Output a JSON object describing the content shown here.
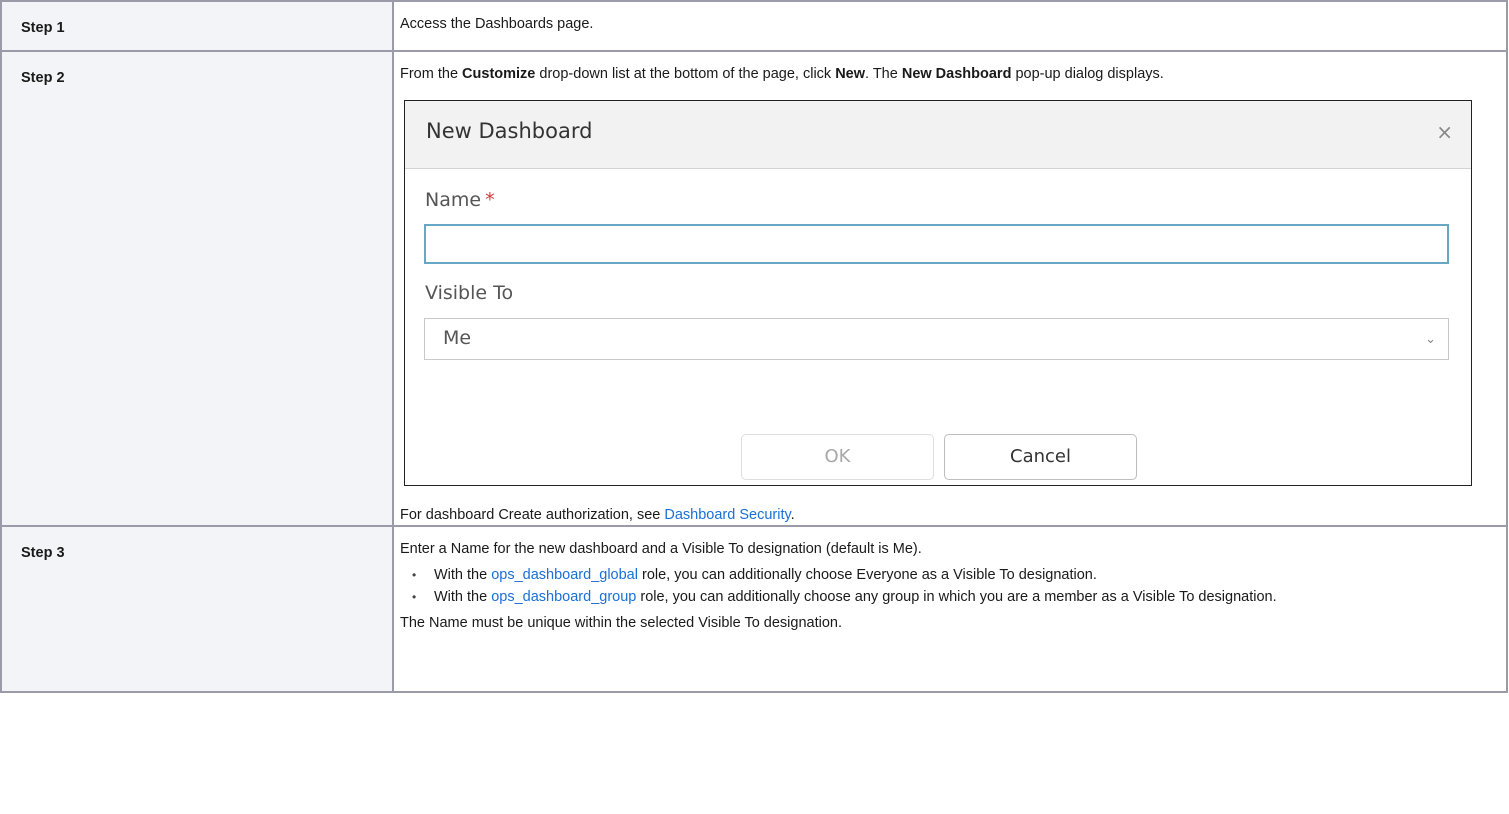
{
  "steps": [
    {
      "label": "Step 1",
      "text": "Access the Dashboards page."
    },
    {
      "label": "Step 2",
      "intro": {
        "part1": "From the ",
        "bold1": "Customize",
        "part2": " drop-down list at the bottom of the page, click ",
        "bold2": "New",
        "part3": ". The ",
        "bold3": "New Dashboard",
        "part4": " pop-up dialog displays."
      },
      "dialog": {
        "title": "New Dashboard",
        "close_icon": "×",
        "name_label": "Name",
        "required_mark": "*",
        "name_value": "",
        "visible_to_label": "Visible To",
        "visible_to_value": "Me",
        "chevron": "⌄",
        "ok_label": "OK",
        "cancel_label": "Cancel"
      },
      "footer": {
        "prefix": "For dashboard Create authorization, see ",
        "link": "Dashboard Security",
        "suffix": "."
      }
    },
    {
      "label": "Step 3",
      "intro": "Enter a Name for the new dashboard and a Visible To designation (default is Me).",
      "bullets": [
        {
          "prefix": "With the ",
          "link": "ops_dashboard_global",
          "suffix": " role, you can additionally choose Everyone as a Visible To designation."
        },
        {
          "prefix": "With the ",
          "link": "ops_dashboard_group",
          "suffix": " role, you can additionally choose any group in which you are a member as a Visible To designation."
        }
      ],
      "note": "The Name must be unique within the selected Visible To designation."
    }
  ],
  "colors": {
    "link": "#1a6fd6",
    "required": "#d23c3c",
    "label_cell_bg": "#f3f4f8",
    "input_focus_border": "#68a8c4"
  }
}
